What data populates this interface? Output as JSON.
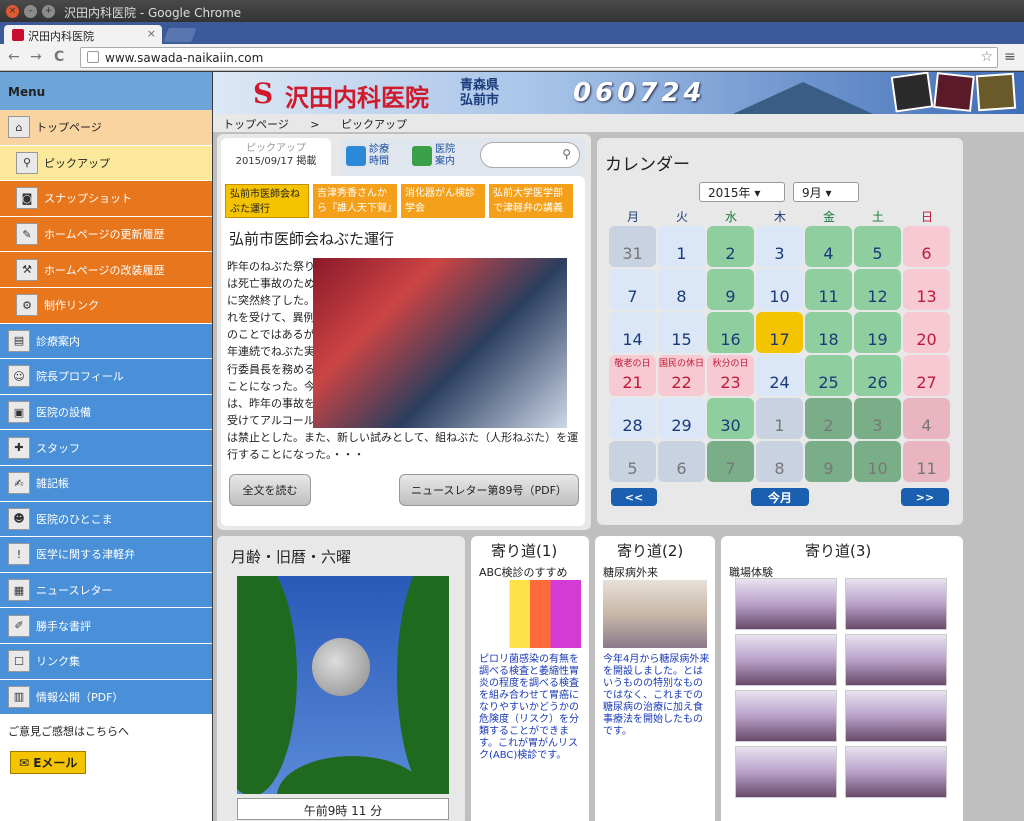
{
  "window": {
    "title": "沢田内科医院 - Google Chrome"
  },
  "tab": {
    "title": "沢田内科医院",
    "close": "×"
  },
  "toolbar": {
    "back": "←",
    "forward": "→",
    "reload": "C",
    "url": "www.sawada-naikaiin.com",
    "star": "☆",
    "menu": "≡"
  },
  "sidebar": {
    "heading": "Menu",
    "items": [
      {
        "label": "トップページ",
        "icon": "home-icon"
      },
      {
        "label": "ピックアップ",
        "icon": "magnifier-icon"
      },
      {
        "label": "スナップショット",
        "icon": "camera-icon"
      },
      {
        "label": "ホームページの更新履歴",
        "icon": "brush-icon"
      },
      {
        "label": "ホームページの改装履歴",
        "icon": "hammer-icon"
      },
      {
        "label": "制作リンク",
        "icon": "link-icon"
      },
      {
        "label": "診療案内",
        "icon": "clinic-icon"
      },
      {
        "label": "院長プロフィール",
        "icon": "doctor-icon"
      },
      {
        "label": "医院の設備",
        "icon": "equipment-icon"
      },
      {
        "label": "スタッフ",
        "icon": "nurse-icon"
      },
      {
        "label": "雑記帳",
        "icon": "notebook-icon"
      },
      {
        "label": "医院のひとこま",
        "icon": "scene-icon"
      },
      {
        "label": "医学に関する津軽弁",
        "icon": "speech-icon"
      },
      {
        "label": "ニュースレター",
        "icon": "newsletter-icon"
      },
      {
        "label": "勝手な書評",
        "icon": "book-icon"
      },
      {
        "label": "リンク集",
        "icon": "handshake-icon"
      },
      {
        "label": "情報公開（PDF）",
        "icon": "document-icon"
      }
    ],
    "feedback": "ご意見ご感想はこちらへ",
    "email": "Eメール"
  },
  "banner": {
    "logo_text": "沢田内科医院",
    "place_line1": "青森県",
    "place_line2": "弘前市",
    "counter": "060724"
  },
  "breadcrumb": {
    "home": "トップページ",
    "sep": ">",
    "current": "ピックアップ"
  },
  "pickup": {
    "tab_label": "ピックアップ",
    "date": "2015/09/17 掲載",
    "link_shinryo": "診療\n時間",
    "link_iin": "医院\n案内",
    "search_placeholder": "",
    "topics": [
      "弘前市医師会ねぶた運行",
      "吉津秀香さんから『誰人天下賀』",
      "消化器がん検診学会",
      "弘前大学医学部で津軽弁の講義"
    ],
    "title": "弘前市医師会ねぶた運行",
    "body_lines": [
      "昨年のねぶた祭り",
      "は死亡事故のため",
      "に突然終了した。そ",
      "れを受けて、異例",
      "のことではあるが2",
      "年連続でねぶた実",
      "行委員長を務める",
      "ことになった。今年",
      "は、昨年の事故を",
      "受けてアルコール"
    ],
    "body_full": "は禁止とした。また、新しい試みとして、組ねぶた（人形ねぶた）を運行することになった。・・・",
    "read_more": "全文を読む",
    "newsletter": "ニュースレター第89号（PDF）"
  },
  "calendar": {
    "title": "カレンダー",
    "year": "2015年",
    "month": "9月",
    "weekdays": [
      "月",
      "火",
      "水",
      "木",
      "金",
      "土",
      "日"
    ],
    "weeks": [
      [
        "31",
        "1",
        "2",
        "3",
        "4",
        "5",
        "6"
      ],
      [
        "7",
        "8",
        "9",
        "10",
        "11",
        "12",
        "13"
      ],
      [
        "14",
        "15",
        "16",
        "17",
        "18",
        "19",
        "20"
      ],
      [
        "21",
        "22",
        "23",
        "24",
        "25",
        "26",
        "27"
      ],
      [
        "28",
        "29",
        "30",
        "1",
        "2",
        "3",
        "4"
      ],
      [
        "5",
        "6",
        "7",
        "8",
        "9",
        "10",
        "11"
      ]
    ],
    "holidays": {
      "21": "敬老の日",
      "22": "国民の休日",
      "23": "秋分の日"
    },
    "prev": "<<",
    "today": "今月",
    "next": ">>"
  },
  "moon": {
    "title": "月齢・旧暦・六曜",
    "time": "午前9時 11 分"
  },
  "yori1": {
    "title": "寄り道(1)",
    "subtitle": "ABC検診のすすめ",
    "text": "ピロリ菌感染の有無を調べる検査と萎縮性胃炎の程度を調べる検査を組み合わせて胃癌になりやすいかどうかの危険度（リスク）を分類することができます。これが胃がんリスク(ABC)検診です。"
  },
  "yori2": {
    "title": "寄り道(2)",
    "subtitle": "糖尿病外来",
    "text": "今年4月から糖尿病外来を開設しました。とはいうものの特別なものではなく、これまでの糖尿病の治療に加え食事療法を開始したものです。"
  },
  "yori3": {
    "title": "寄り道(3)",
    "subtitle": "職場体験"
  },
  "colors": {
    "blue_menu": "#4a90d9",
    "orange_menu": "#e8761c",
    "weekday_green": "#8fcf9f",
    "today": "#f5c400",
    "sunday_pink": "#f7c9d2"
  }
}
